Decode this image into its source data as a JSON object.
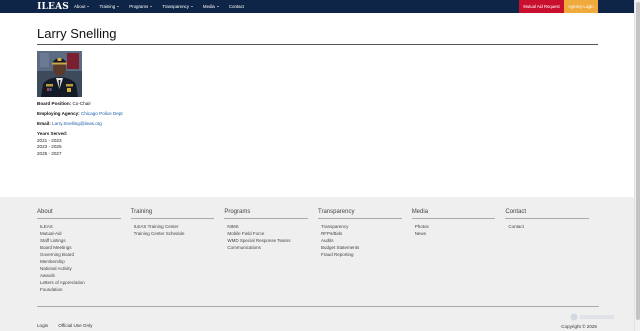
{
  "navbar": {
    "brand": "ILEAS",
    "items": [
      {
        "label": "About",
        "dropdown": true
      },
      {
        "label": "Training",
        "dropdown": true
      },
      {
        "label": "Programs",
        "dropdown": true
      },
      {
        "label": "Transparency",
        "dropdown": true
      },
      {
        "label": "Media",
        "dropdown": true
      },
      {
        "label": "Contact",
        "dropdown": false
      }
    ],
    "mutual_aid": "Mutual Aid Request",
    "agency_login": "Agency Login"
  },
  "profile": {
    "name": "Larry Snelling",
    "position_label": "Board Position:",
    "position": "Co-Chair",
    "agency_label": "Employing Agency:",
    "agency": "Chicago Police Dept",
    "email_label": "Email:",
    "email": "Larry.Snelling@ileas.org",
    "years_label": "Years Served:",
    "years": [
      "2021 - 2023",
      "2023 - 2025",
      "2025 - 2027"
    ]
  },
  "footer": {
    "columns": [
      {
        "title": "About",
        "links": [
          "ILEAS",
          "Mutual-Aid",
          "Staff Listings",
          "Board Meetings",
          "Governing Board",
          "Membership",
          "National Activity",
          "Awards",
          "Letters of Appreciation",
          "Foundation"
        ]
      },
      {
        "title": "Training",
        "links": [
          "ILEAS Training Center",
          "Training Center Schedule"
        ]
      },
      {
        "title": "Programs",
        "links": [
          "NIMS",
          "Mobile Field Force",
          "WMD Special Response Teams",
          "Communications"
        ]
      },
      {
        "title": "Transparency",
        "links": [
          "Transparency",
          "RFPs/Bids",
          "Audits",
          "Budget Statements",
          "Fraud Reporting"
        ]
      },
      {
        "title": "Media",
        "links": [
          "Photos",
          "News"
        ]
      },
      {
        "title": "Contact",
        "links": [
          "Contact"
        ]
      }
    ],
    "bottom_links": [
      "Login",
      "Official Use Only"
    ],
    "copyright": "Copyright © 2025"
  },
  "colors": {
    "navbar_bg": "#0f2548",
    "mutual_aid_bg": "#c8102e",
    "agency_login_bg": "#f0a93b",
    "link": "#1a5aa8",
    "footer_bg": "#efefef"
  }
}
